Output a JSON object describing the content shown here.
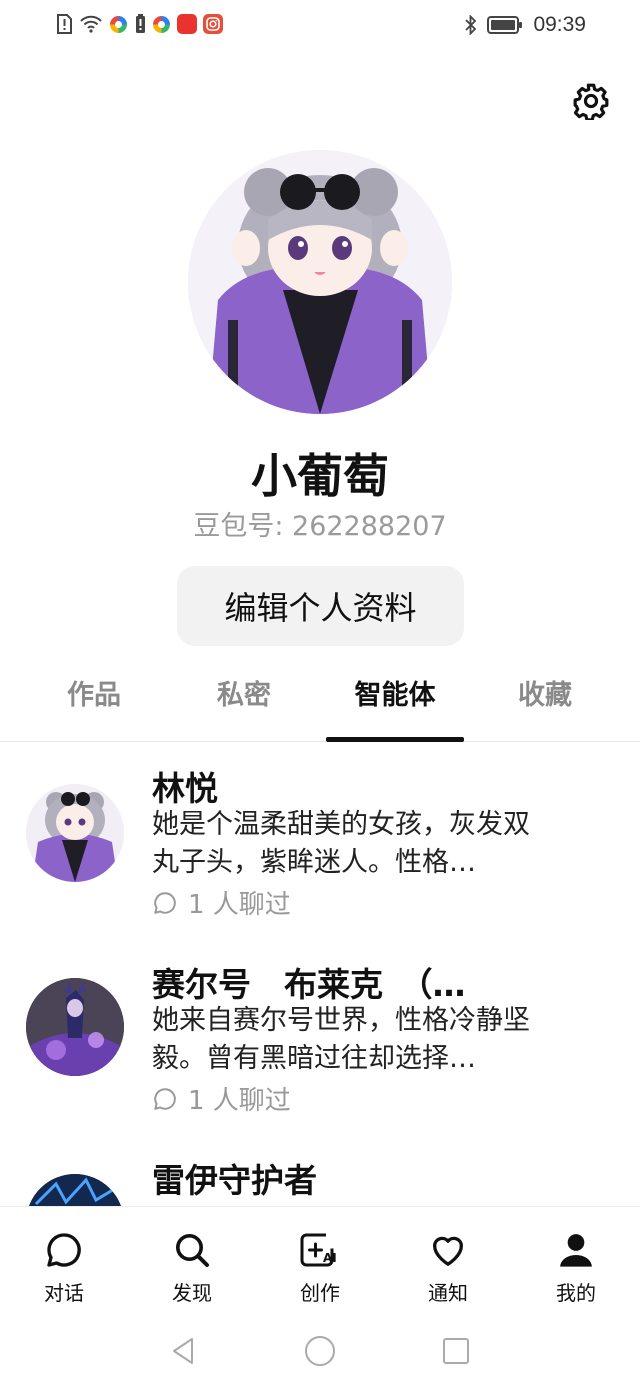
{
  "status_bar": {
    "time": "09:39",
    "icons": [
      "sim-alert-icon",
      "wifi-icon",
      "app-icon",
      "battery-alert-icon",
      "app-icon",
      "huawei-app-icon",
      "instagram-icon",
      "bluetooth-icon",
      "battery-icon"
    ]
  },
  "settings_icon": "gear-icon",
  "profile": {
    "name": "小葡萄",
    "id_text": "豆包号: 262288207",
    "edit_button": "编辑个人资料"
  },
  "tabs": [
    {
      "label": "作品",
      "active": false
    },
    {
      "label": "私密",
      "active": false
    },
    {
      "label": "智能体",
      "active": true
    },
    {
      "label": "收藏",
      "active": false
    }
  ],
  "agents": [
    {
      "name": "林悦",
      "description": "她是个温柔甜美的女孩，灰发双丸子头，紫眸迷人。性格…",
      "chat_count": "1 人聊过"
    },
    {
      "name": "赛尔号　布莱克　（…",
      "description": "她来自赛尔号世界，性格冷静坚毅。曾有黑暗过往却选择…",
      "chat_count": "1 人聊过"
    },
    {
      "name": "雷伊守护者",
      "description": "",
      "chat_count": ""
    }
  ],
  "bottom_nav": [
    {
      "label": "对话",
      "icon": "chat-bubble-icon"
    },
    {
      "label": "发现",
      "icon": "search-icon"
    },
    {
      "label": "创作",
      "icon": "create-ai-icon"
    },
    {
      "label": "通知",
      "icon": "heart-icon"
    },
    {
      "label": "我的",
      "icon": "person-icon"
    }
  ],
  "colors": {
    "accent": "#111111",
    "muted": "#9a9a9a",
    "button_bg": "#f2f2f2"
  }
}
